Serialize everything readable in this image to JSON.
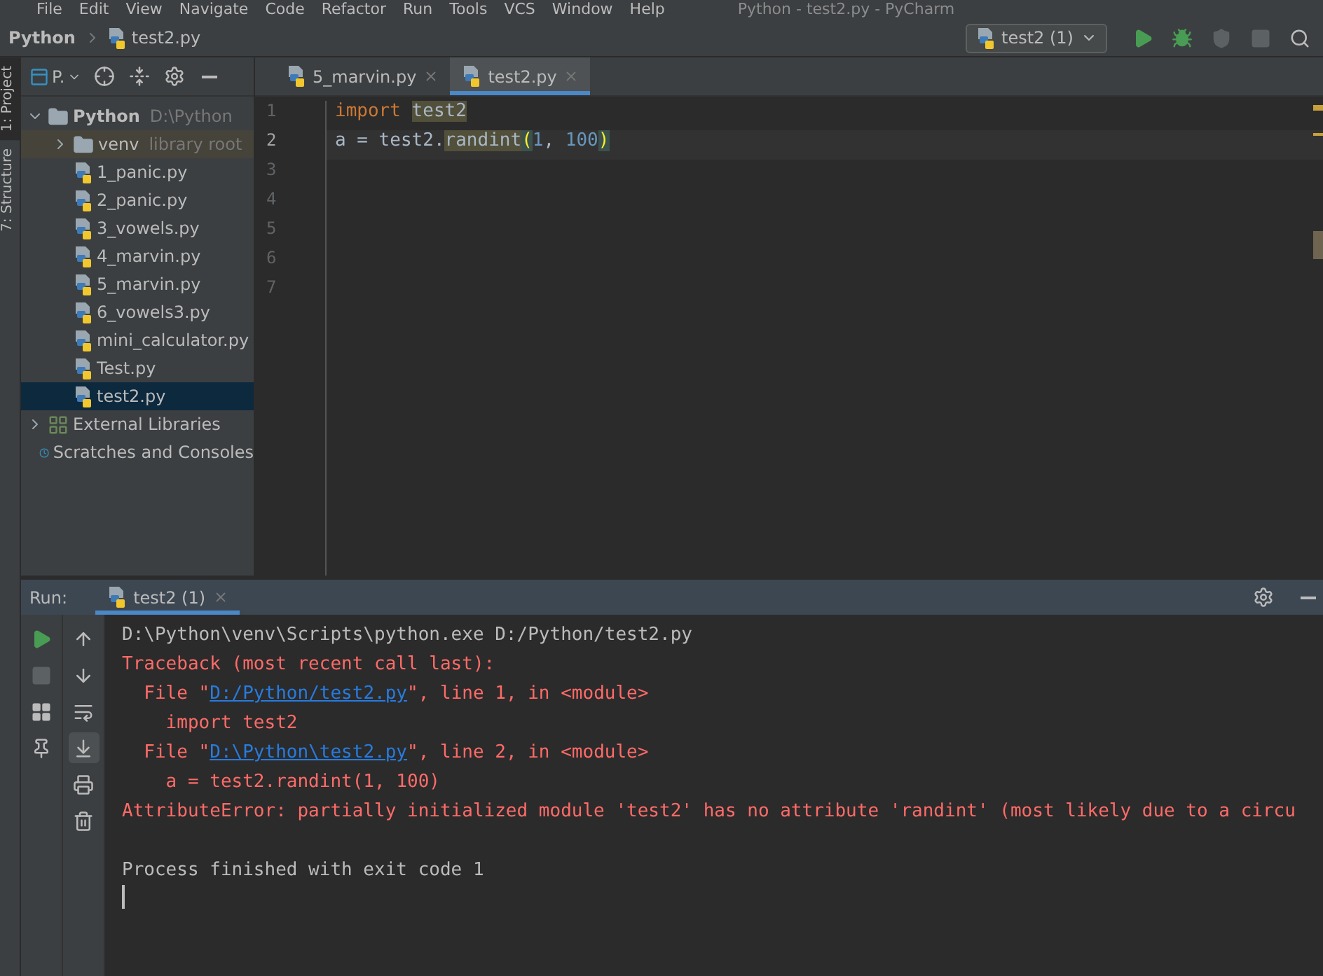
{
  "menu_bar": {
    "items": [
      "File",
      "Edit",
      "View",
      "Navigate",
      "Code",
      "Refactor",
      "Run",
      "Tools",
      "VCS",
      "Window",
      "Help"
    ],
    "window_title": "Python - test2.py - PyCharm"
  },
  "nav_bar": {
    "breadcrumb": [
      "Python",
      "test2.py"
    ],
    "run_config": "test2 (1)",
    "actions": [
      {
        "kind": "run",
        "disabled": false
      },
      {
        "kind": "debug",
        "disabled": false
      },
      {
        "kind": "coverage",
        "disabled": true
      },
      {
        "kind": "stop",
        "disabled": true
      },
      {
        "kind": "search",
        "disabled": false
      }
    ]
  },
  "tool_strip": [
    {
      "label": "1: Project",
      "selected": true
    },
    {
      "label": "7: Structure",
      "selected": false
    }
  ],
  "project_panel": {
    "view_label": "P.",
    "tree": [
      {
        "name": "Python",
        "detail": "D:\\Python",
        "kind": "folder",
        "expanded": true,
        "selected": false,
        "children": [
          {
            "name": "venv",
            "detail": "library root",
            "kind": "library_root",
            "expanded": false,
            "selected": false
          },
          {
            "name": "1_panic.py",
            "kind": "file",
            "selected": false
          },
          {
            "name": "2_panic.py",
            "kind": "file",
            "selected": false
          },
          {
            "name": "3_vowels.py",
            "kind": "file",
            "selected": false
          },
          {
            "name": "4_marvin.py",
            "kind": "file",
            "selected": false
          },
          {
            "name": "5_marvin.py",
            "kind": "file",
            "selected": false
          },
          {
            "name": "6_vowels3.py",
            "kind": "file",
            "selected": false
          },
          {
            "name": "mini_calculator.py",
            "kind": "file",
            "selected": false
          },
          {
            "name": "Test.py",
            "kind": "file",
            "selected": false
          },
          {
            "name": "test2.py",
            "kind": "file",
            "selected": true
          }
        ]
      },
      {
        "name": "External Libraries",
        "kind": "libraries",
        "expanded": false,
        "selected": false
      },
      {
        "name": "Scratches and Consoles",
        "kind": "scratches",
        "selected": false
      }
    ]
  },
  "editor": {
    "tabs": [
      {
        "label": "5_marvin.py",
        "selected": false
      },
      {
        "label": "test2.py",
        "selected": true
      }
    ],
    "lines": [
      {
        "number": "1",
        "current": false,
        "tokens": [
          {
            "text": "import ",
            "kind": "keyword"
          },
          {
            "text": "test2",
            "kind": "usage"
          }
        ]
      },
      {
        "number": "2",
        "current": true,
        "tokens": [
          {
            "text": "a = test2.",
            "kind": "plain"
          },
          {
            "text": "randint",
            "kind": "usage"
          },
          {
            "text": "(",
            "kind": "brace"
          },
          {
            "text": "1",
            "kind": "number"
          },
          {
            "text": ", ",
            "kind": "plain"
          },
          {
            "text": "100",
            "kind": "number"
          },
          {
            "text": ")",
            "kind": "brace"
          }
        ]
      },
      {
        "number": "3",
        "current": false
      },
      {
        "number": "4",
        "current": false
      },
      {
        "number": "5",
        "current": false
      },
      {
        "number": "6",
        "current": false
      },
      {
        "number": "7",
        "current": false
      }
    ]
  },
  "run_panel": {
    "label": "Run:",
    "tab": {
      "label": "test2 (1)",
      "selected": true
    },
    "side_tools": [
      {
        "kind": "rerun",
        "disabled": false
      },
      {
        "kind": "stop",
        "disabled": true
      },
      {
        "kind": "layout",
        "disabled": false
      },
      {
        "kind": "pin",
        "disabled": false
      }
    ],
    "console_tools": [
      {
        "kind": "up",
        "selected": false
      },
      {
        "kind": "down",
        "selected": false
      },
      {
        "kind": "wrap",
        "selected": false
      },
      {
        "kind": "scroll_end",
        "selected": true
      },
      {
        "kind": "print",
        "selected": false
      },
      {
        "kind": "trash",
        "selected": false
      }
    ],
    "console": [
      {
        "kind": "command",
        "segments": [
          {
            "text": "D:\\Python\\venv\\Scripts\\python.exe D:/Python/test2.py",
            "kind": "text"
          }
        ]
      },
      {
        "kind": "error",
        "segments": [
          {
            "text": "Traceback (most recent call last):",
            "kind": "text"
          }
        ]
      },
      {
        "kind": "error",
        "segments": [
          {
            "text": "  File \"",
            "kind": "text"
          },
          {
            "text": "D:/Python/test2.py",
            "kind": "link"
          },
          {
            "text": "\", line 1, in <module>",
            "kind": "text"
          }
        ]
      },
      {
        "kind": "error",
        "segments": [
          {
            "text": "    import test2",
            "kind": "text"
          }
        ]
      },
      {
        "kind": "error",
        "segments": [
          {
            "text": "  File \"",
            "kind": "text"
          },
          {
            "text": "D:\\Python\\test2.py",
            "kind": "link"
          },
          {
            "text": "\", line 2, in <module>",
            "kind": "text"
          }
        ]
      },
      {
        "kind": "error",
        "segments": [
          {
            "text": "    a = test2.randint(1, 100)",
            "kind": "text"
          }
        ]
      },
      {
        "kind": "error",
        "segments": [
          {
            "text": "AttributeError: partially initialized module 'test2' has no attribute 'randint' (most likely due to a circu",
            "kind": "text"
          }
        ]
      },
      {
        "kind": "blank"
      },
      {
        "kind": "command",
        "segments": [
          {
            "text": "Process finished with exit code 1",
            "kind": "text"
          }
        ]
      }
    ]
  }
}
